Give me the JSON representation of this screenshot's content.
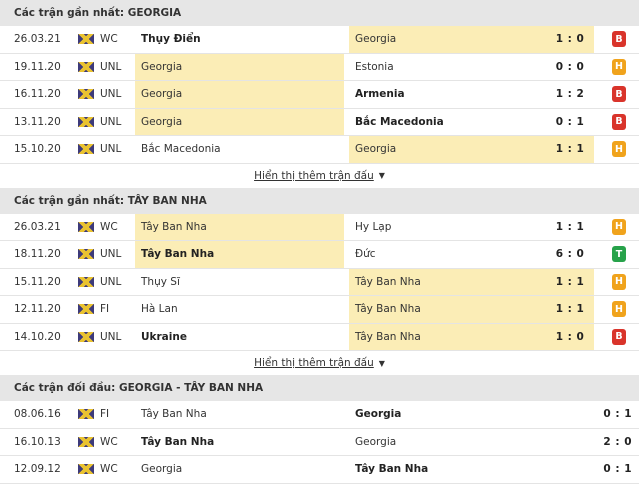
{
  "colors": {
    "loss": "#d9342b",
    "draw": "#f0a31c",
    "win": "#27a24a",
    "highlight": "#fbedb6",
    "header_bg": "#e6e6e6"
  },
  "sections": [
    {
      "title": "Các trận gần nhất: GEORGIA",
      "more_label": "Hiển thị thêm trận đấu",
      "rows": [
        {
          "date": "26.03.21",
          "comp": "WC",
          "home": "Thụy Điển",
          "away": "Georgia",
          "score": "1 : 0",
          "result": "B",
          "hl": "away",
          "bold": "home"
        },
        {
          "date": "19.11.20",
          "comp": "UNL",
          "home": "Georgia",
          "away": "Estonia",
          "score": "0 : 0",
          "result": "H",
          "hl": "home",
          "bold": ""
        },
        {
          "date": "16.11.20",
          "comp": "UNL",
          "home": "Georgia",
          "away": "Armenia",
          "score": "1 : 2",
          "result": "B",
          "hl": "home",
          "bold": "away"
        },
        {
          "date": "13.11.20",
          "comp": "UNL",
          "home": "Georgia",
          "away": "Bắc Macedonia",
          "score": "0 : 1",
          "result": "B",
          "hl": "home",
          "bold": "away"
        },
        {
          "date": "15.10.20",
          "comp": "UNL",
          "home": "Bắc Macedonia",
          "away": "Georgia",
          "score": "1 : 1",
          "result": "H",
          "hl": "away",
          "bold": ""
        }
      ]
    },
    {
      "title": "Các trận gần nhất: TÂY BAN NHA",
      "more_label": "Hiển thị thêm trận đấu",
      "rows": [
        {
          "date": "26.03.21",
          "comp": "WC",
          "home": "Tây Ban Nha",
          "away": "Hy Lạp",
          "score": "1 : 1",
          "result": "H",
          "hl": "home",
          "bold": ""
        },
        {
          "date": "18.11.20",
          "comp": "UNL",
          "home": "Tây Ban Nha",
          "away": "Đức",
          "score": "6 : 0",
          "result": "T",
          "hl": "home",
          "bold": "home"
        },
        {
          "date": "15.11.20",
          "comp": "UNL",
          "home": "Thụy Sĩ",
          "away": "Tây Ban Nha",
          "score": "1 : 1",
          "result": "H",
          "hl": "away",
          "bold": ""
        },
        {
          "date": "12.11.20",
          "comp": "FI",
          "home": "Hà Lan",
          "away": "Tây Ban Nha",
          "score": "1 : 1",
          "result": "H",
          "hl": "away",
          "bold": ""
        },
        {
          "date": "14.10.20",
          "comp": "UNL",
          "home": "Ukraine",
          "away": "Tây Ban Nha",
          "score": "1 : 0",
          "result": "B",
          "hl": "away",
          "bold": "home"
        }
      ]
    }
  ],
  "h2h": {
    "title": "Các trận đối đầu: GEORGIA - TÂY BAN NHA",
    "rows": [
      {
        "date": "08.06.16",
        "comp": "FI",
        "home": "Tây Ban Nha",
        "away": "Georgia",
        "score": "0 : 1",
        "bold": "away"
      },
      {
        "date": "16.10.13",
        "comp": "WC",
        "home": "Tây Ban Nha",
        "away": "Georgia",
        "score": "2 : 0",
        "bold": "home"
      },
      {
        "date": "12.09.12",
        "comp": "WC",
        "home": "Georgia",
        "away": "Tây Ban Nha",
        "score": "0 : 1",
        "bold": "away"
      }
    ]
  }
}
